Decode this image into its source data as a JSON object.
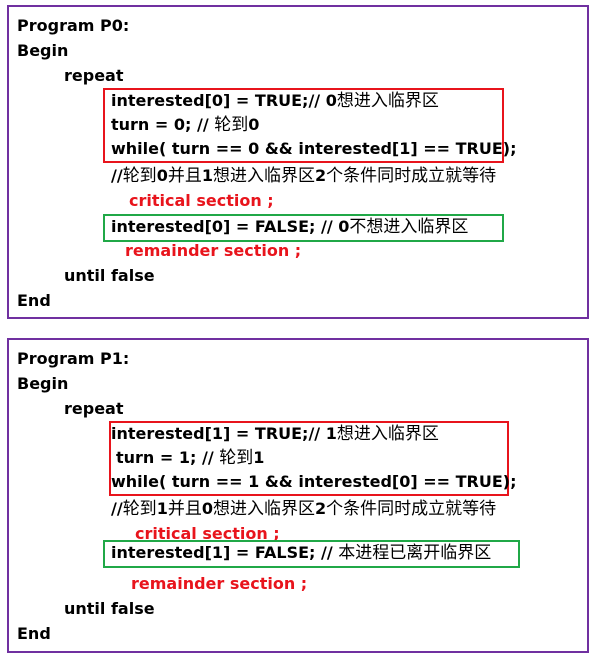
{
  "colors": {
    "panel_border": "#7030a0",
    "red": "#e8141c",
    "green": "#20a847",
    "text": "#000000"
  },
  "programs": [
    {
      "title": "Program P0:",
      "begin": "Begin",
      "repeat": "repeat",
      "lines": [
        {
          "code": "interested[0] = TRUE;// 0",
          "cn": "想进入临界区"
        },
        {
          "code": "turn = 0; // ",
          "cn": "轮到",
          "code2": "0"
        },
        {
          "code": "while( turn == 0 && interested[1] == TRUE);"
        }
      ],
      "comment": {
        "p1": "//",
        "c1": "轮到",
        "p2": "0",
        "c2": "并且",
        "p3": "1",
        "c3": "想进入临界区",
        "p4": "2",
        "c4": "个条件同时成立就等待"
      },
      "critical": "critical section ;",
      "exit_line": {
        "code": "interested[0] = FALSE; // 0",
        "cn": "不想进入临界区"
      },
      "remainder": "remainder section ;",
      "until": "until false",
      "end": "End"
    },
    {
      "title": "Program P1:",
      "begin": "Begin",
      "repeat": "repeat",
      "lines": [
        {
          "code": "interested[1] = TRUE;// 1",
          "cn": "想进入临界区"
        },
        {
          "code": "turn = 1; // ",
          "cn": "轮到",
          "code2": "1"
        },
        {
          "code": "while( turn == 1 && interested[0] == TRUE);"
        }
      ],
      "comment": {
        "p1": "//",
        "c1": "轮到",
        "p2": "1",
        "c2": "并且",
        "p3": "0",
        "c3": "想进入临界区",
        "p4": "2",
        "c4": "个条件同时成立就等待"
      },
      "critical": "critical section ;",
      "exit_line": {
        "code": "interested[1] = FALSE; // ",
        "cn": "本进程已离开临界区"
      },
      "remainder": "remainder section ;",
      "until": "until false",
      "end": "End"
    }
  ]
}
